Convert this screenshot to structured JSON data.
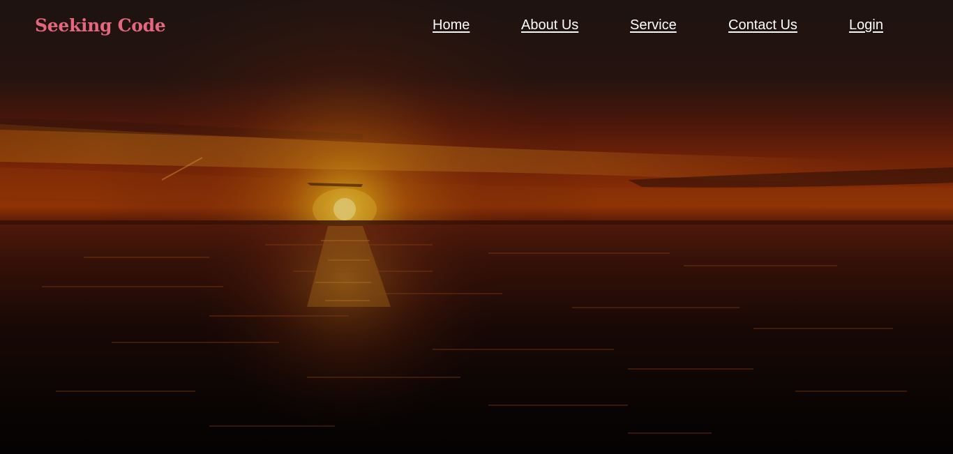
{
  "brand": {
    "name": "Seeking Code",
    "color": "#e4667f"
  },
  "nav": {
    "home": "Home",
    "about": "About Us",
    "service": "Service",
    "contact": "Contact Us",
    "login": "Login"
  },
  "hero": {
    "image": "ocean-sunset-background"
  },
  "colors": {
    "nav_text": "#ffffff",
    "sky_dark": "#231614",
    "horizon_glow": "#d28a10",
    "sea_dark": "#050303"
  }
}
